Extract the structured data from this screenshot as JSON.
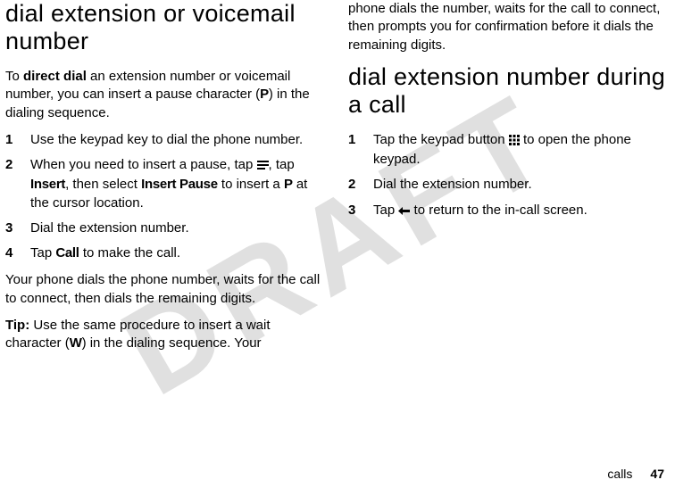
{
  "watermark": "DRAFT",
  "left": {
    "heading": "dial extension or voicemail number",
    "intro_pre": "To ",
    "intro_bold": "direct dial",
    "intro_post": " an extension number or voicemail number, you can insert a pause character (",
    "intro_p": "P",
    "intro_end": ") in the dialing sequence.",
    "steps": [
      {
        "n": "1",
        "text": "Use the keypad key to dial the phone number."
      },
      {
        "n": "2",
        "a": "When you need to insert a pause, tap ",
        "b": ", tap ",
        "c": "Insert",
        "d": ", then select ",
        "e": "Insert Pause",
        "f": " to insert a ",
        "g": "P",
        "h": " at the cursor location."
      },
      {
        "n": "3",
        "text": "Dial the extension number."
      },
      {
        "n": "4",
        "a": "Tap ",
        "b": "Call",
        "c": " to make the call."
      }
    ],
    "after": "Your phone dials the phone number, waits for the call to connect, then dials the remaining digits.",
    "tip_label": "Tip:",
    "tip_a": " Use the same procedure to insert a wait character (",
    "tip_w": "W",
    "tip_b": ") in the dialing sequence. Your"
  },
  "right": {
    "carry": "phone dials the number, waits for the call to connect, then prompts you for confirmation before it dials the remaining digits.",
    "heading": "dial extension number during a call",
    "steps": [
      {
        "n": "1",
        "a": "Tap the keypad button ",
        "b": " to open the phone keypad."
      },
      {
        "n": "2",
        "text": "Dial the extension number."
      },
      {
        "n": "3",
        "a": "Tap ",
        "b": " to return to the in-call screen."
      }
    ]
  },
  "footer": {
    "section": "calls",
    "page": "47"
  }
}
